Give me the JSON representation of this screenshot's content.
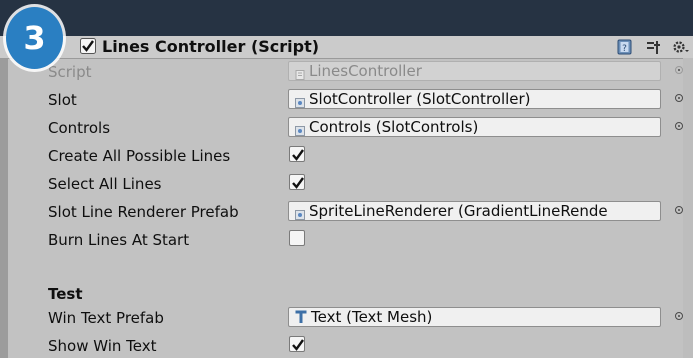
{
  "step_badge": "3",
  "component": {
    "title": "Lines Controller (Script)",
    "enabled": true,
    "header_icons": [
      "help-book-icon",
      "presets-icon",
      "gear-icon"
    ]
  },
  "fields": {
    "script": {
      "label": "Script",
      "value": "LinesController",
      "icon": "script-icon"
    },
    "slot": {
      "label": "Slot",
      "value": "SlotController (SlotController)",
      "icon": "object-icon"
    },
    "controls": {
      "label": "Controls",
      "value": "Controls (SlotControls)",
      "icon": "object-icon"
    },
    "create_all_possible_lines": {
      "label": "Create All Possible Lines",
      "checked": true
    },
    "select_all_lines": {
      "label": "Select All Lines",
      "checked": true
    },
    "slot_line_renderer_prefab": {
      "label": "Slot Line Renderer Prefab",
      "value": "SpriteLineRenderer (GradientLineRende",
      "icon": "object-icon"
    },
    "burn_lines_at_start": {
      "label": "Burn Lines At Start",
      "checked": false
    }
  },
  "test_section": {
    "header": "Test",
    "win_text_prefab": {
      "label": "Win Text Prefab",
      "value": "Text (Text Mesh)",
      "icon": "text-mesh-icon"
    },
    "show_win_text": {
      "label": "Show Win Text",
      "checked": true
    }
  },
  "colors": {
    "inspector_bg": "#c2c2c2",
    "top_bar": "#263343",
    "badge": "#2a7fc2"
  }
}
